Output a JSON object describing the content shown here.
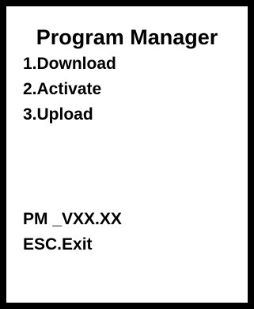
{
  "screen": {
    "title": "Program Manager",
    "menu": [
      {
        "label": "1.Download"
      },
      {
        "label": "2.Activate"
      },
      {
        "label": "3.Upload"
      }
    ],
    "version": "PM _VXX.XX",
    "exit_label": "ESC.Exit"
  },
  "colors": {
    "border": "#000000",
    "background": "#ffffff",
    "text": "#000000"
  }
}
